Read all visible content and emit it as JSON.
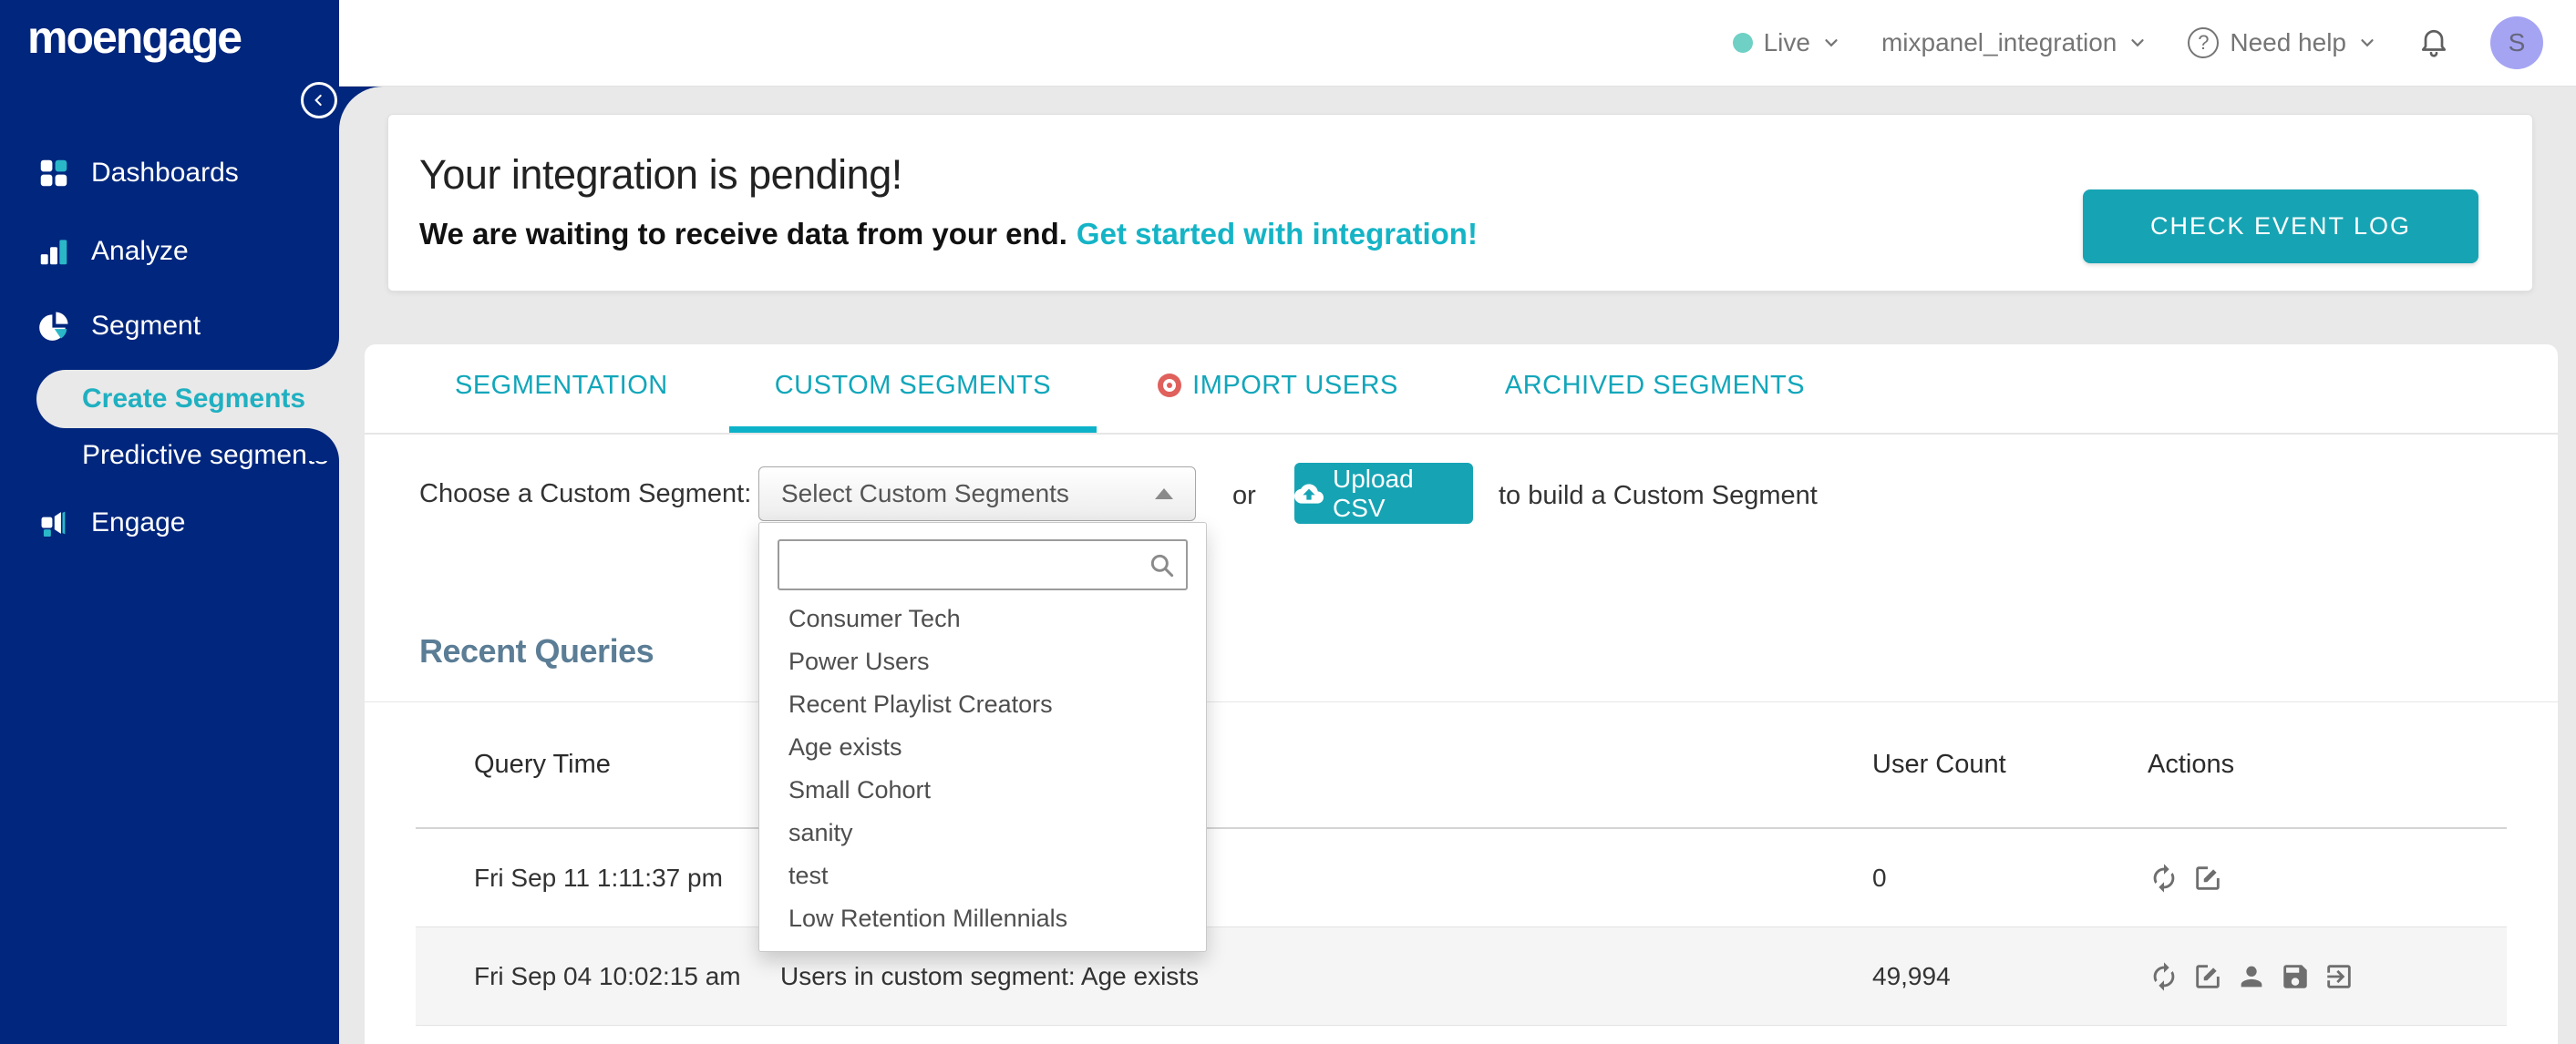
{
  "colors": {
    "sidebar_navy": "#00267d",
    "accent_teal": "#16a4b4",
    "link_teal": "#14b4c6",
    "active_item_teal": "#1fb0c1",
    "heading_slate": "#5b7d95",
    "import_dot_red": "#e0605c",
    "live_dot_teal": "#6fd0c5",
    "avatar_bg": "#a5a4f3",
    "page_bg": "#e9e9e9"
  },
  "brand": {
    "logo_text": "moengage"
  },
  "topbar": {
    "env": {
      "label": "Live"
    },
    "workspace": {
      "label": "mixpanel_integration"
    },
    "help": {
      "label": "Need help",
      "icon_glyph": "?"
    },
    "avatar": {
      "initial": "S"
    }
  },
  "sidebar": {
    "items": [
      {
        "label": "Dashboards"
      },
      {
        "label": "Analyze"
      },
      {
        "label": "Segment"
      },
      {
        "label": "Create Segments"
      },
      {
        "label": "Predictive segments"
      },
      {
        "label": "Engage"
      }
    ]
  },
  "banner": {
    "title": "Your integration is pending!",
    "message": "We are waiting to receive data from your end.",
    "link_label": "Get started with integration!",
    "button_label": "CHECK EVENT LOG"
  },
  "tabs": [
    {
      "label": "SEGMENTATION"
    },
    {
      "label": "CUSTOM SEGMENTS"
    },
    {
      "label": "IMPORT USERS"
    },
    {
      "label": "ARCHIVED SEGMENTS"
    }
  ],
  "picker": {
    "label": "Choose a Custom Segment:",
    "select_value": "Select Custom Segments",
    "or_text": "or",
    "upload_label": "Upload CSV",
    "suffix": "to build a Custom Segment"
  },
  "dropdown": {
    "search_placeholder": "",
    "items": [
      "Consumer Tech",
      "Power Users",
      "Recent Playlist Creators",
      "Age exists",
      "Small Cohort",
      "sanity",
      "test",
      "Low Retention Millennials"
    ]
  },
  "recent_queries": {
    "title": "Recent Queries",
    "columns": {
      "time": "Query Time",
      "count": "User Count",
      "actions": "Actions"
    },
    "rows": [
      {
        "time": "Fri Sep 11 1:11:37 pm",
        "query": "",
        "count": "0"
      },
      {
        "time": "Fri Sep 04 10:02:15 am",
        "query": "Users in custom segment: Age exists",
        "count": "49,994"
      }
    ]
  }
}
